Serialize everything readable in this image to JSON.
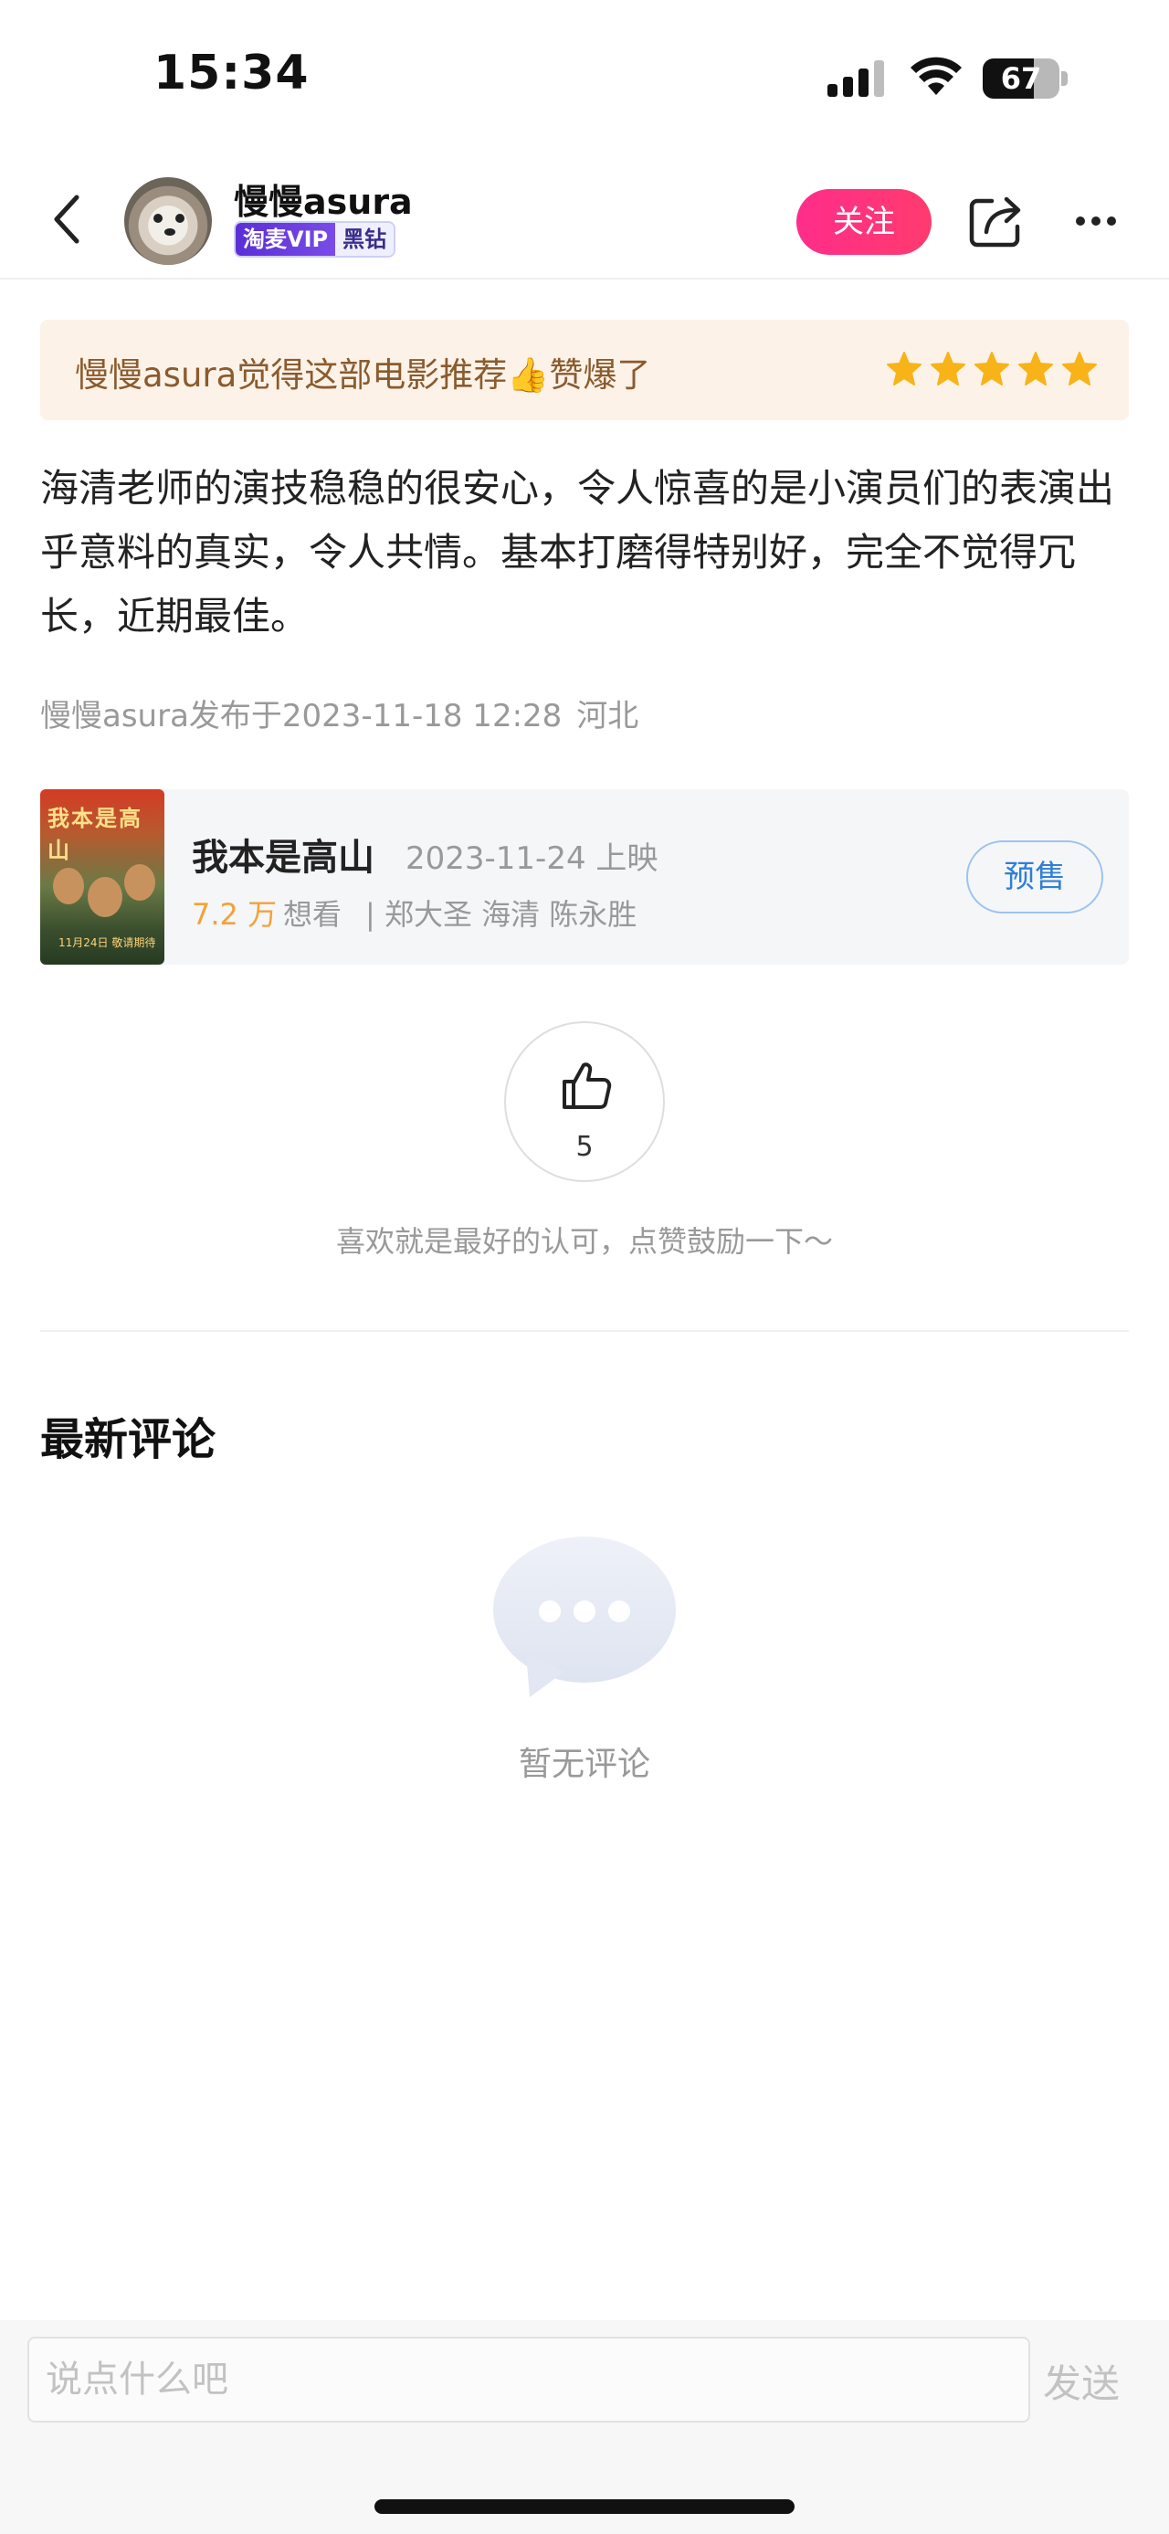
{
  "status_bar": {
    "time": "15:34",
    "battery_text": "67",
    "battery_level": 0.67,
    "icons": [
      "cellular-signal-icon",
      "wifi-icon",
      "battery-icon"
    ]
  },
  "nav": {
    "back_icon": "chevron-left-icon",
    "username": "慢慢asura",
    "vip_label": "淘麦VIP",
    "diamond_label": "黑钻",
    "follow_label": "关注",
    "share_icon": "share-icon",
    "more_icon": "more-icon",
    "follow_color": "#ff2d8a"
  },
  "rating": {
    "text": "慢慢asura觉得这部电影推荐👍赞爆了",
    "stars": 5,
    "star_color": "#f7b318"
  },
  "review": {
    "text": "海清老师的演技稳稳的很安心，令人惊喜的是小演员们的表演出乎意料的真实，令人共情。基本打磨得特别好，完全不觉得冗长，近期最佳。",
    "meta": "慢慢asura发布于2023-11-18 12:28",
    "location": "河北"
  },
  "movie": {
    "poster_title": "我本是高山",
    "poster_date": "11月24日 敬请期待",
    "title": "我本是高山",
    "release": "2023-11-24 上映",
    "want_count": "7.2 万",
    "want_label": "想看",
    "cast": "| 郑大圣 海清 陈永胜",
    "presale_label": "预售"
  },
  "like": {
    "count": "5",
    "hint": "喜欢就是最好的认可，点赞鼓励一下～"
  },
  "comments": {
    "title": "最新评论",
    "empty_text": "暂无评论"
  },
  "input": {
    "placeholder": "说点什么吧",
    "send_label": "发送"
  }
}
